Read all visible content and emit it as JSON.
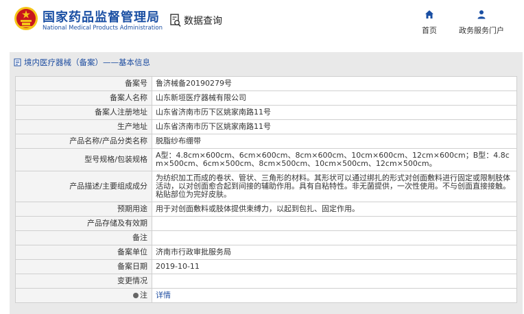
{
  "header": {
    "logo_cn": "国家药品监督管理局",
    "logo_en": "National Medical Products Administration",
    "query_label": "数据查询",
    "nav": [
      {
        "label": "首页",
        "icon": "home-icon"
      },
      {
        "label": "政务服务门户",
        "icon": "user-icon"
      }
    ]
  },
  "colors": {
    "brand_blue": "#1a4fa3",
    "emblem_red": "#c8161d",
    "emblem_gold": "#f5c518",
    "panel_bg": "#e9e9e9",
    "key_cell_bg": "#f4f4f4"
  },
  "panel": {
    "title": "境内医疗器械（备案）——基本信息"
  },
  "rows": [
    {
      "label": "备案号",
      "value": "鲁济械备20190279号"
    },
    {
      "label": "备案人名称",
      "value": "山东新垣医疗器械有限公司"
    },
    {
      "label": "备案人注册地址",
      "value": "山东省济南市历下区姚家南路11号"
    },
    {
      "label": "生产地址",
      "value": "山东省济南市历下区姚家南路11号"
    },
    {
      "label": "产品名称/产品分类名称",
      "value": "脱脂纱布绷带"
    },
    {
      "label": "型号规格/包装规格",
      "value": "A型：4.8cm×600cm、6cm×600cm、8cm×600cm、10cm×600cm、12cm×600cm；B型：4.8cm×500cm、6cm×500cm、8cm×500cm、10cm×500cm、12cm×500cm。"
    },
    {
      "label": "产品描述/主要组成成分",
      "value": "为纺织加工而成的卷状、管状、三角形的材料。其形状可以通过绑扎的形式对创面敷料进行固定或限制肢体活动，以对创面愈合起到间接的辅助作用。具有自粘特性。非无菌提供，一次性使用。不与创面直接接触。粘贴部位为完好皮肤。"
    },
    {
      "label": "预期用途",
      "value": "用于对创面敷料或肢体提供束缚力，以起到包扎、固定作用。"
    },
    {
      "label": "产品存储及有效期",
      "value": ""
    },
    {
      "label": "备注",
      "value": ""
    },
    {
      "label": "备案单位",
      "value": "济南市行政审批服务局"
    },
    {
      "label": "备案日期",
      "value": "2019-10-11"
    },
    {
      "label": "变更情况",
      "value": ""
    },
    {
      "label": "注",
      "value": "详情"
    }
  ]
}
